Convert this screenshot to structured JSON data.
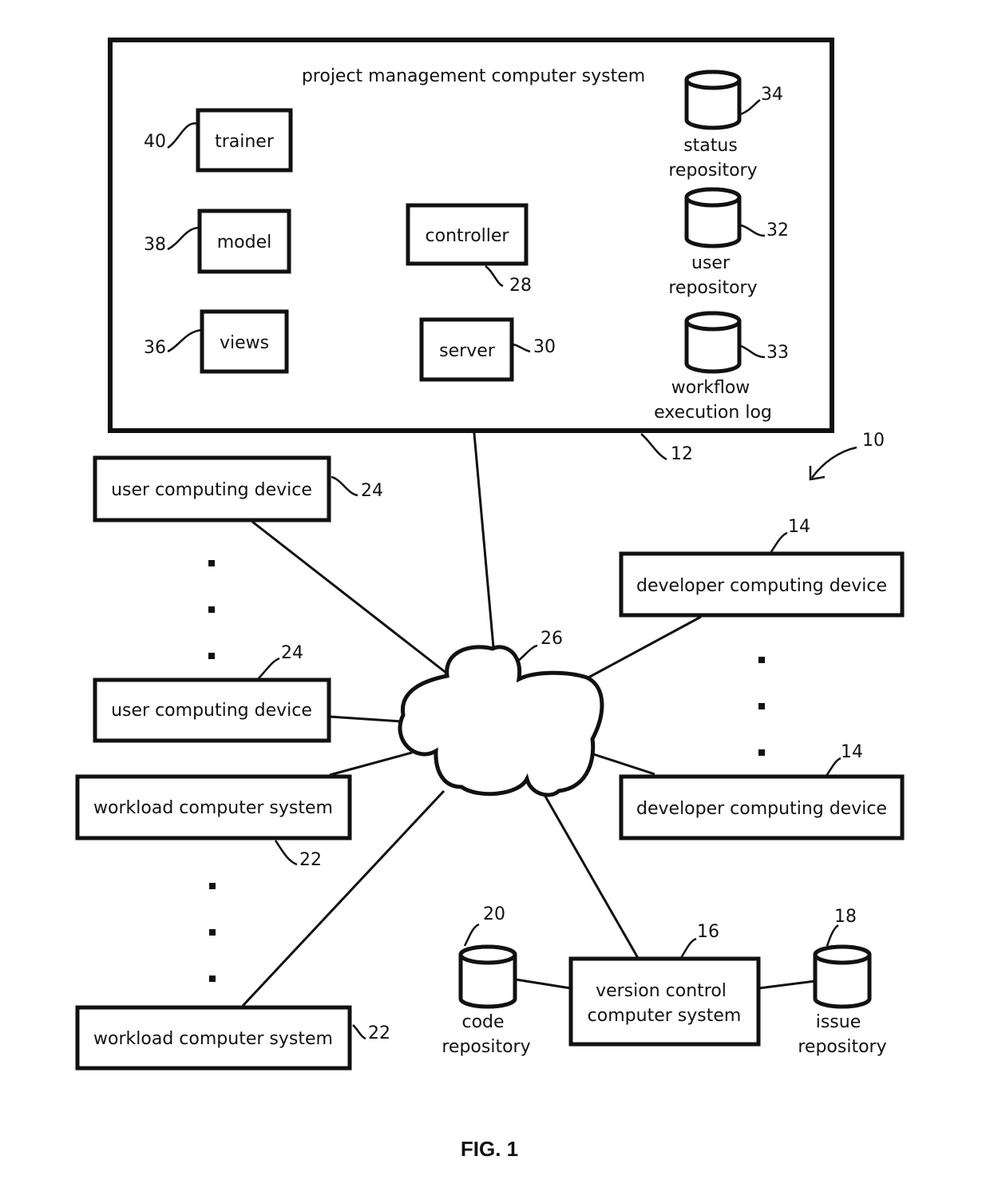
{
  "figure": {
    "caption": "FIG. 1",
    "system_ref": "10"
  },
  "pm_system": {
    "title": "project management computer system",
    "ref": "12",
    "components": {
      "trainer": {
        "label": "trainer",
        "ref": "40"
      },
      "model": {
        "label": "model",
        "ref": "38"
      },
      "views": {
        "label": "views",
        "ref": "36"
      },
      "controller": {
        "label": "controller",
        "ref": "28"
      },
      "server": {
        "label": "server",
        "ref": "30"
      },
      "status_repo": {
        "label_line1": "status",
        "label_line2": "repository",
        "ref": "34"
      },
      "user_repo": {
        "label_line1": "user",
        "label_line2": "repository",
        "ref": "32"
      },
      "workflow_log": {
        "label_line1": "workflow",
        "label_line2": "execution log",
        "ref": "33"
      }
    }
  },
  "network": {
    "ref": "26"
  },
  "user_devices": [
    {
      "label": "user computing device",
      "ref": "24"
    },
    {
      "label": "user computing device",
      "ref": "24"
    }
  ],
  "workload_systems": [
    {
      "label": "workload computer system",
      "ref": "22"
    },
    {
      "label": "workload computer system",
      "ref": "22"
    }
  ],
  "developer_devices": [
    {
      "label": "developer computing device",
      "ref": "14"
    },
    {
      "label": "developer computing device",
      "ref": "14"
    }
  ],
  "version_control": {
    "label_line1": "version control",
    "label_line2": "computer system",
    "ref": "16"
  },
  "code_repo": {
    "label_line1": "code",
    "label_line2": "repository",
    "ref": "20"
  },
  "issue_repo": {
    "label_line1": "issue",
    "label_line2": "repository",
    "ref": "18"
  }
}
